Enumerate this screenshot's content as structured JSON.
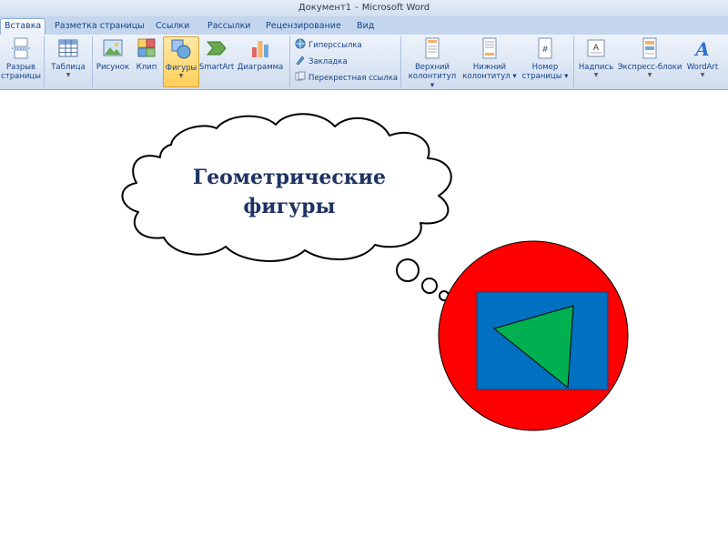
{
  "window": {
    "doc_name": "Документ1",
    "app_name": "Microsoft Word"
  },
  "tabs": [
    {
      "label": "Вставка",
      "active": true
    },
    {
      "label": "Разметка страницы"
    },
    {
      "label": "Ссылки"
    },
    {
      "label": "Рассылки"
    },
    {
      "label": "Рецензирование"
    },
    {
      "label": "Вид"
    }
  ],
  "ribbon": {
    "page_break": {
      "line1": "Разрыв",
      "line2": "страницы"
    },
    "table": {
      "label": "Таблица"
    },
    "picture": {
      "label": "Рисунок"
    },
    "clip": {
      "label": "Клип"
    },
    "shapes": {
      "label": "Фигуры",
      "selected": true
    },
    "smartart": {
      "label": "SmartArt"
    },
    "chart": {
      "label": "Диаграмма"
    },
    "hyperlink": {
      "label": "Гиперссылка"
    },
    "bookmark": {
      "label": "Закладка"
    },
    "cross_ref": {
      "label": "Перекрестная ссылка"
    },
    "header": {
      "line1": "Верхний",
      "line2": "колонтитул"
    },
    "footer": {
      "line1": "Нижний",
      "line2": "колонтитул"
    },
    "page_number": {
      "line1": "Номер",
      "line2": "страницы"
    },
    "textbox": {
      "label": "Надпись"
    },
    "quick_parts": {
      "label": "Экспресс-блоки"
    },
    "wordart": {
      "label": "WordArt"
    }
  },
  "document": {
    "bubble_line1": "Геометрические",
    "bubble_line2": "фигуры",
    "colors": {
      "text": "#1f3264",
      "circle": "#ff0000",
      "rectangle": "#0070c0",
      "triangle": "#00b050"
    }
  }
}
